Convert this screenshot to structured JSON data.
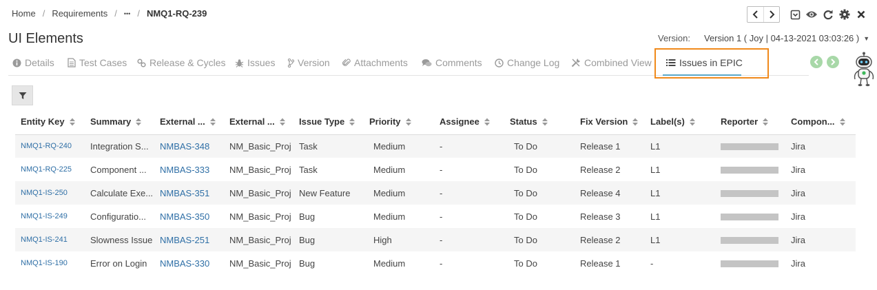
{
  "breadcrumb": {
    "home": "Home",
    "section": "Requirements",
    "ellipsis": "•••",
    "current": "NMQ1-RQ-239",
    "separator": "/"
  },
  "page": {
    "title": "UI Elements"
  },
  "version": {
    "label": "Version:",
    "value": "Version 1 ( Joy | 04-13-2021 03:03:26 )"
  },
  "toolbar": {
    "icons": [
      "chevron-left-icon",
      "chevron-right-icon",
      "save-icon",
      "watch-icon",
      "refresh-icon",
      "settings-icon",
      "close-icon"
    ]
  },
  "tabs": [
    {
      "label": "Details",
      "icon": "info-icon"
    },
    {
      "label": "Test Cases",
      "icon": "document-icon"
    },
    {
      "label": "Release & Cycles",
      "icon": "link-icon"
    },
    {
      "label": "Issues",
      "icon": "bug-icon"
    },
    {
      "label": "Version",
      "icon": "branch-icon"
    },
    {
      "label": "Attachments",
      "icon": "paperclip-icon"
    },
    {
      "label": "Comments",
      "icon": "comments-icon"
    },
    {
      "label": "Change Log",
      "icon": "clock-icon"
    },
    {
      "label": "Combined View",
      "icon": "tools-icon"
    },
    {
      "label": "Issues in EPIC",
      "icon": "list-icon"
    }
  ],
  "active_tab": "Issues in EPIC",
  "colors": {
    "accent_link": "#2f6fa6",
    "active_highlight": "#f0891a",
    "tab_underline": "#5aa7c8",
    "nav_circle": "#a8d8a8"
  },
  "table": {
    "columns": [
      "Entity Key",
      "Summary",
      "External ...",
      "External ...",
      "Issue Type",
      "Priority",
      "Assignee",
      "Status",
      "Fix Version",
      "Label(s)",
      "Reporter",
      "Compon..."
    ],
    "rows": [
      {
        "key": "NMQ1-RQ-240",
        "summary": "Integration S...",
        "ext_key": "NMBAS-348",
        "ext_project": "NM_Basic_Proj",
        "issue_type": "Task",
        "priority": "Medium",
        "assignee": "-",
        "status": "To Do",
        "fix_version": "Release 1",
        "labels": "L1",
        "component": "Jira"
      },
      {
        "key": "NMQ1-RQ-225",
        "summary": "Component ...",
        "ext_key": "NMBAS-333",
        "ext_project": "NM_Basic_Proj",
        "issue_type": "Task",
        "priority": "Medium",
        "assignee": "-",
        "status": "To Do",
        "fix_version": "Release 2",
        "labels": "L1",
        "component": "Jira"
      },
      {
        "key": "NMQ1-IS-250",
        "summary": "Calculate Exe...",
        "ext_key": "NMBAS-351",
        "ext_project": "NM_Basic_Proj",
        "issue_type": "New Feature",
        "priority": "Medium",
        "assignee": "-",
        "status": "To Do",
        "fix_version": "Release 4",
        "labels": "L1",
        "component": "Jira"
      },
      {
        "key": "NMQ1-IS-249",
        "summary": "Configuratio...",
        "ext_key": "NMBAS-350",
        "ext_project": "NM_Basic_Proj",
        "issue_type": "Bug",
        "priority": "Medium",
        "assignee": "-",
        "status": "To Do",
        "fix_version": "Release 3",
        "labels": "L1",
        "component": "Jira"
      },
      {
        "key": "NMQ1-IS-241",
        "summary": "Slowness Issue",
        "ext_key": "NMBAS-251",
        "ext_project": "NM_Basic_Proj",
        "issue_type": "Bug",
        "priority": "High",
        "assignee": "-",
        "status": "To Do",
        "fix_version": "Release 2",
        "labels": "L1",
        "component": "Jira"
      },
      {
        "key": "NMQ1-IS-190",
        "summary": "Error on Login",
        "ext_key": "NMBAS-330",
        "ext_project": "NM_Basic_Proj",
        "issue_type": "Bug",
        "priority": "Medium",
        "assignee": "-",
        "status": "To Do",
        "fix_version": "Release 1",
        "labels": "-",
        "component": "Jira"
      }
    ]
  }
}
